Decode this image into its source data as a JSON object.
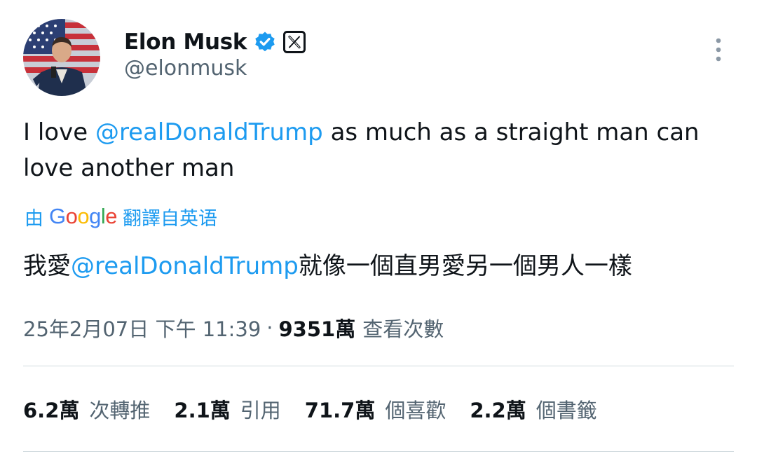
{
  "author": {
    "display_name": "Elon Musk",
    "handle": "@elonmusk",
    "verified_icon": "verified-badge-icon",
    "affiliation_icon": "x-logo-icon"
  },
  "tweet": {
    "text_prefix": "I love ",
    "mention": "@realDonaldTrump",
    "text_suffix": " as much as a straight man can love another man"
  },
  "translation": {
    "prefix": "由",
    "google_logo": "Google",
    "suffix": "翻譯自英语",
    "text_prefix": "我愛",
    "mention": "@realDonaldTrump",
    "text_suffix": "就像一個直男愛另一個男人一樣"
  },
  "meta": {
    "timestamp": "25年2月07日 下午 11:39",
    "separator": "·",
    "views_count": "9351萬",
    "views_label": "查看次數"
  },
  "stats": [
    {
      "count": "6.2萬",
      "label": "次轉推"
    },
    {
      "count": "2.1萬",
      "label": "引用"
    },
    {
      "count": "71.7萬",
      "label": "個喜歡"
    },
    {
      "count": "2.2萬",
      "label": "個書籤"
    }
  ],
  "colors": {
    "accent": "#1d9bf0",
    "text": "#0f1419",
    "secondary": "#536471",
    "divider": "#cfd9de"
  }
}
